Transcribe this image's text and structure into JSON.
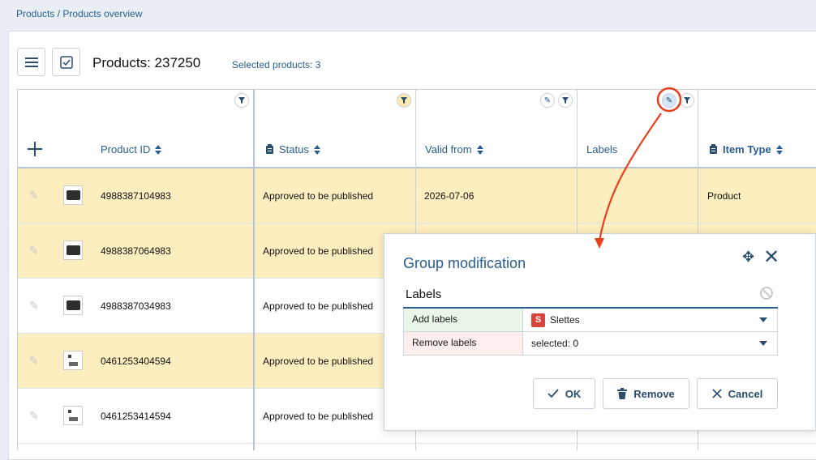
{
  "breadcrumb": "Products / Products overview",
  "toolbar": {
    "menu_icon": "hamburger-menu-icon",
    "select_icon": "checkbox-icon"
  },
  "title": "Products: 237250",
  "selected_text": "Selected products: 3",
  "columns": {
    "product_id": "Product ID",
    "status": "Status",
    "valid_from": "Valid from",
    "labels": "Labels",
    "item_type": "Item Type"
  },
  "rows": [
    {
      "id": "4988387104983",
      "status": "Approved to be published",
      "valid_from": "2026-07-06",
      "item_type": "Product",
      "highlighted": true
    },
    {
      "id": "4988387064983",
      "status": "Approved to be published",
      "valid_from": "",
      "item_type": "",
      "highlighted": true
    },
    {
      "id": "4988387034983",
      "status": "Approved to be published",
      "valid_from": "",
      "item_type": "",
      "highlighted": false
    },
    {
      "id": "0461253404594",
      "status": "Approved to be published",
      "valid_from": "",
      "item_type": "",
      "highlighted": true
    },
    {
      "id": "0461253414594",
      "status": "Approved to be published",
      "valid_from": "",
      "item_type": "",
      "highlighted": false
    }
  ],
  "dialog": {
    "title": "Group modification",
    "section": "Labels",
    "add_label": "Add labels",
    "add_badge": "S",
    "add_value": "Slettes",
    "remove_label": "Remove labels",
    "remove_value": "selected: 0",
    "ok": "OK",
    "remove": "Remove",
    "cancel": "Cancel"
  },
  "colors": {
    "highlight": "#fdeebf",
    "accent": "#2a5d8f",
    "annotation": "#e8401c"
  }
}
